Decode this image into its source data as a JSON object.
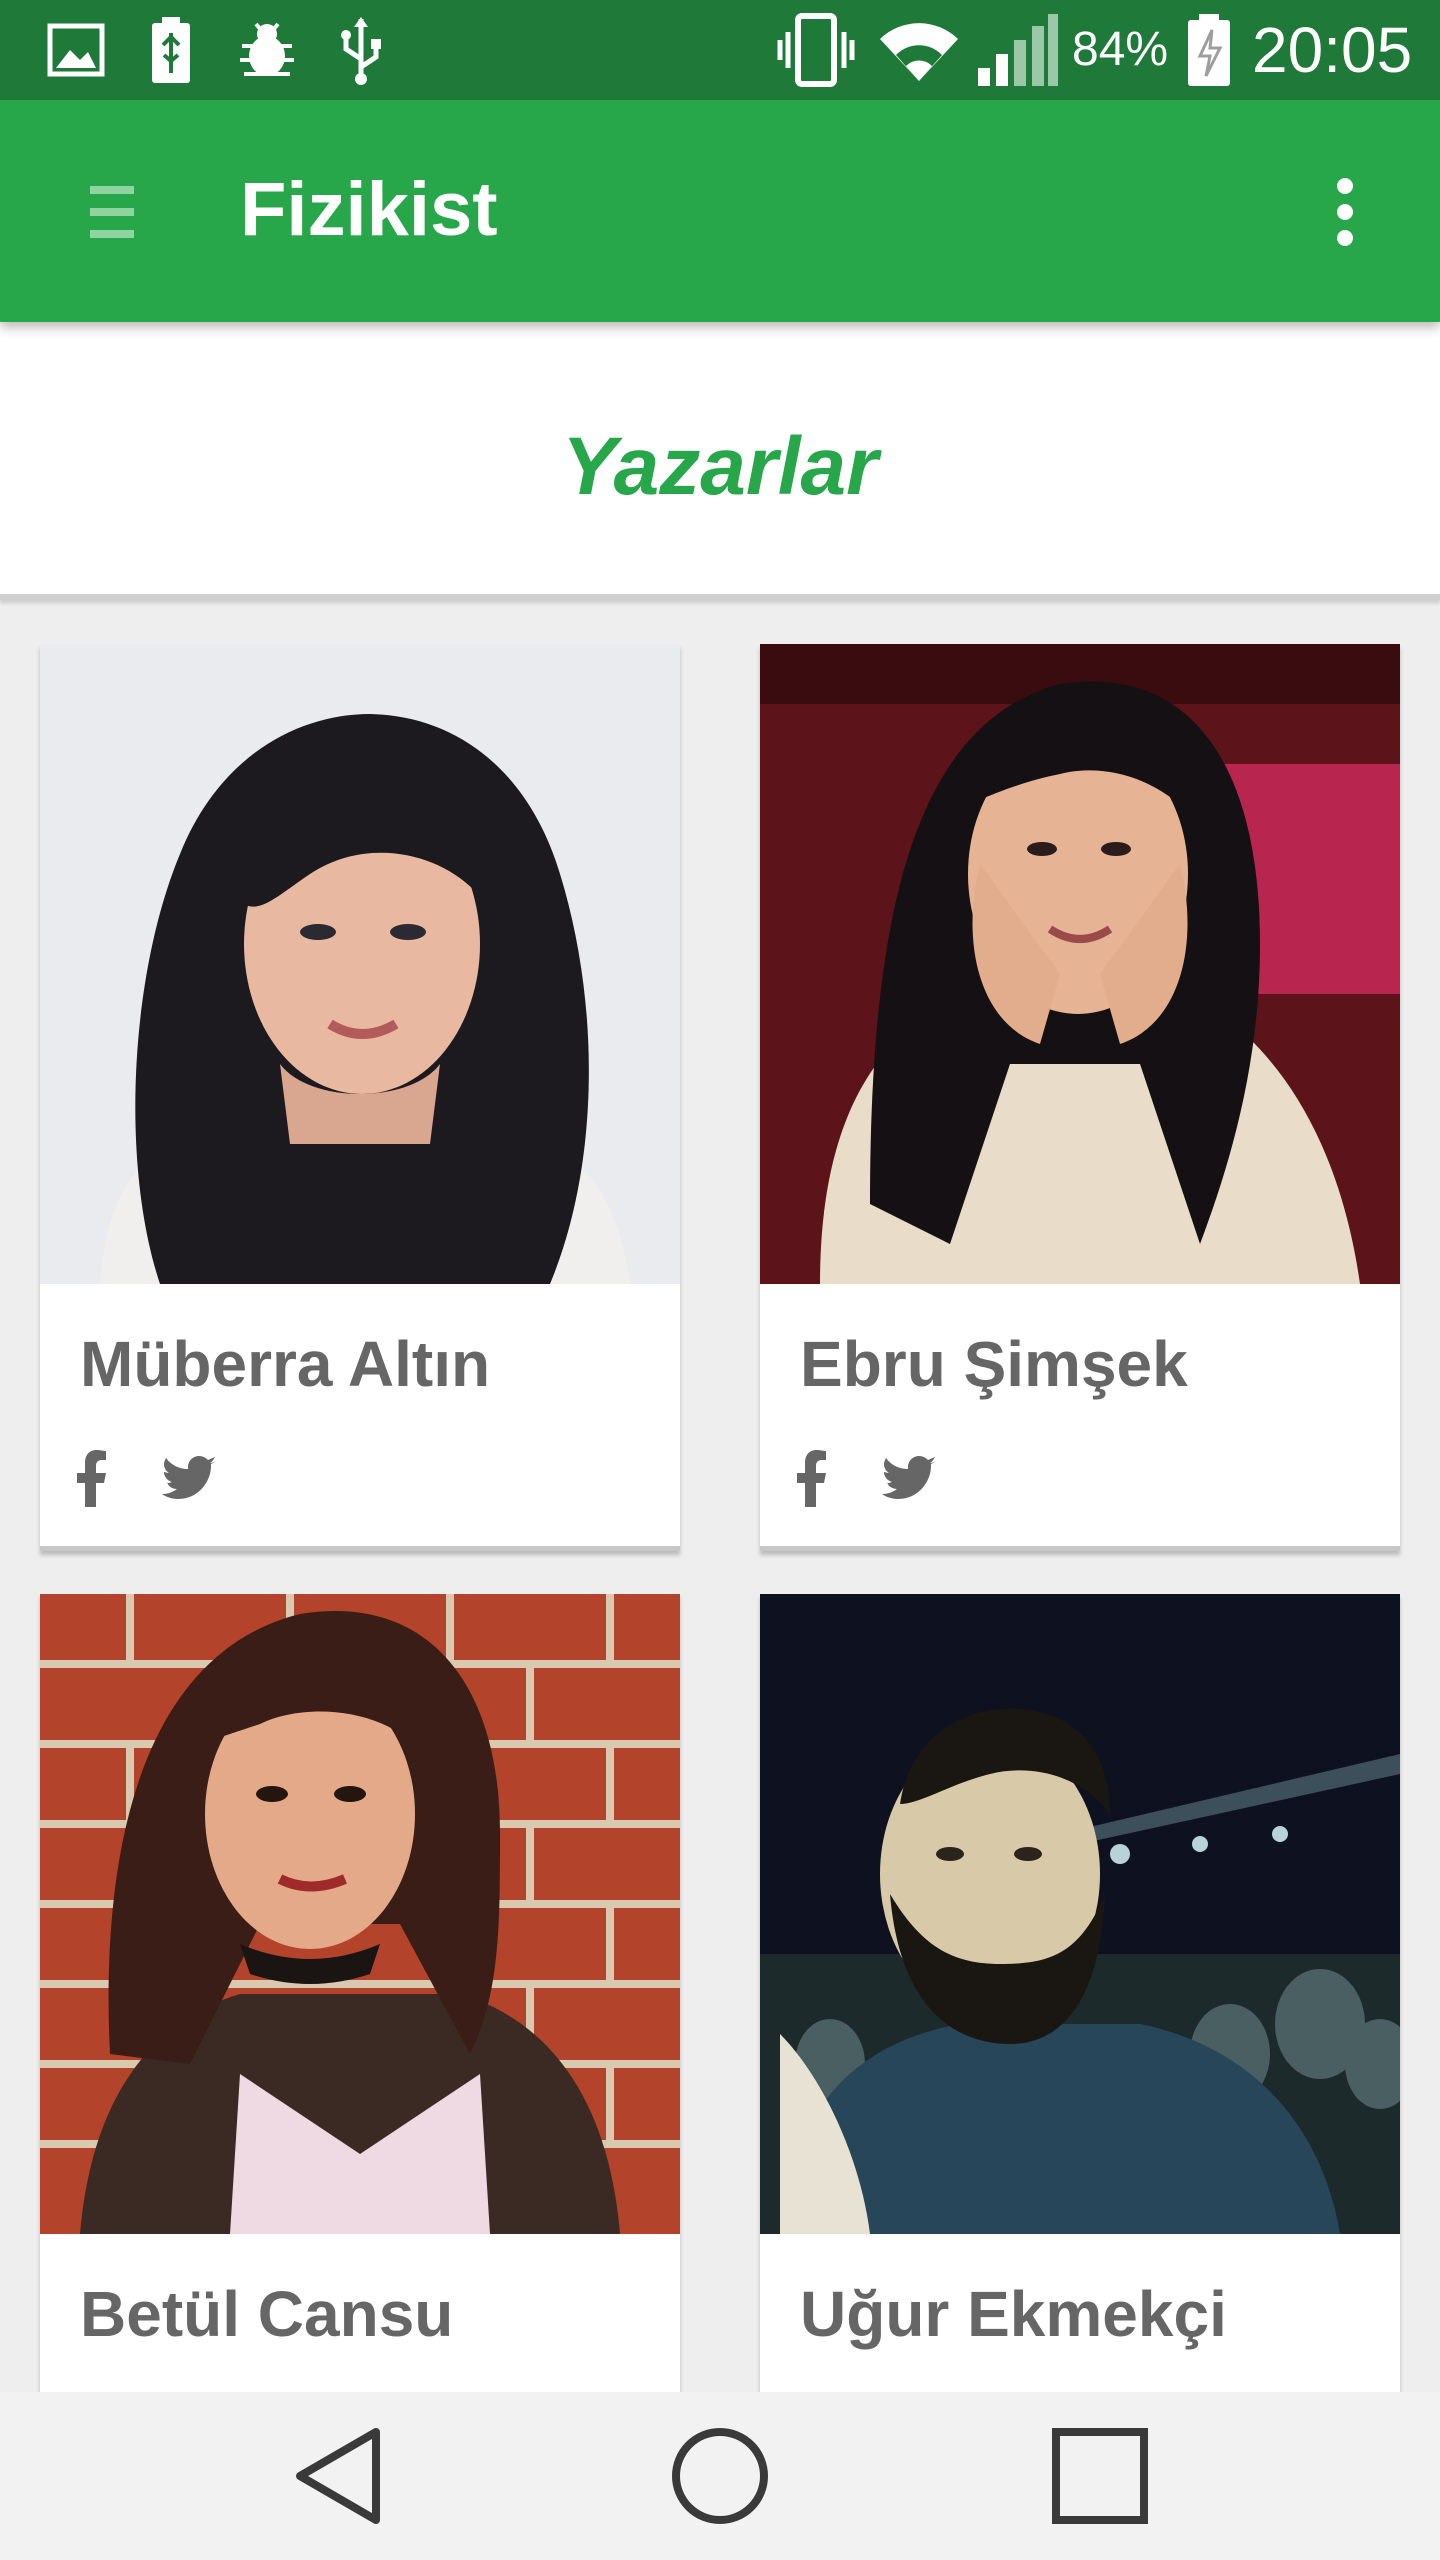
{
  "status_bar": {
    "battery_percent": "84%",
    "time": "20:05",
    "icons": [
      "image-icon",
      "usb-battery-icon",
      "debug-icon",
      "usb-icon",
      "vibrate-icon",
      "wifi-icon",
      "signal-icon",
      "battery-charging-icon"
    ]
  },
  "app_bar": {
    "title": "Fizikist",
    "menu_icon": "hamburger-menu-icon",
    "overflow_icon": "more-vert-icon",
    "color": "#27a64a"
  },
  "section": {
    "title": "Yazarlar",
    "color": "#27a64a"
  },
  "authors": [
    {
      "name": "Müberra Altın",
      "social": [
        "facebook-icon",
        "twitter-icon"
      ]
    },
    {
      "name": "Ebru Şimşek",
      "social": [
        "facebook-icon",
        "twitter-icon"
      ]
    },
    {
      "name": "Betül Cansu"
    },
    {
      "name": "Uğur Ekmekçi"
    }
  ],
  "nav_bar": {
    "buttons": [
      "back-icon",
      "home-icon",
      "recents-icon"
    ]
  }
}
